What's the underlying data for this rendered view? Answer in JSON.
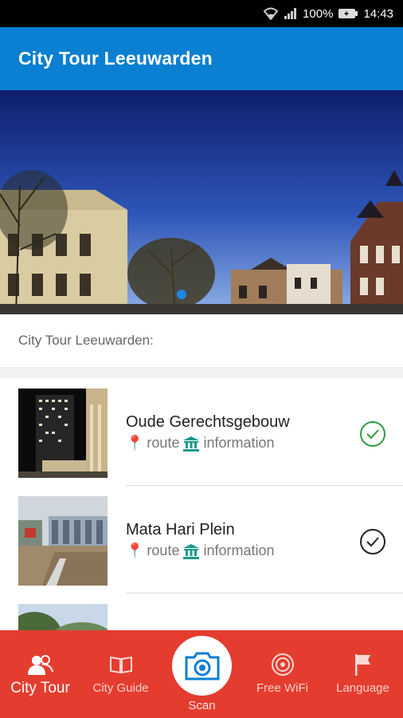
{
  "status_bar": {
    "battery": "100%",
    "time": "14:43"
  },
  "app_bar": {
    "title": "City Tour Leeuwarden"
  },
  "section": {
    "label": "City Tour Leeuwarden:"
  },
  "tour_items": [
    {
      "title": "Oude Gerechtsgebouw",
      "route": "route",
      "information": "information",
      "visited": true,
      "check_color": "#2e9e3e"
    },
    {
      "title": "Mata Hari Plein",
      "route": "route",
      "information": "information",
      "visited": false,
      "check_color": "#222222"
    }
  ],
  "bottom_nav": {
    "city_tour": "City Tour",
    "city_guide": "City Guide",
    "scan": "Scan",
    "free_wifi": "Free WiFi",
    "language": "Language"
  },
  "colors": {
    "app_bar": "#0b7fd1",
    "bottom_nav": "#e43d2f",
    "accent": "#1e88e5"
  }
}
